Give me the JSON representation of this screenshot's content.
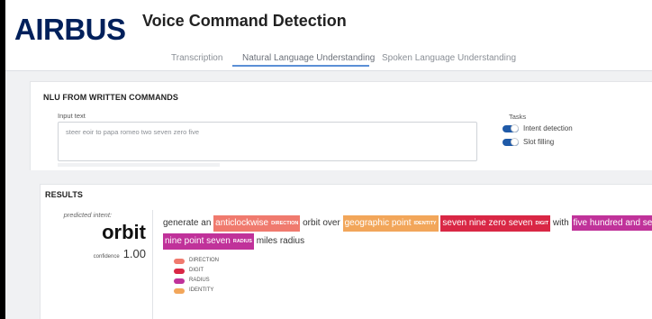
{
  "header": {
    "logo": "AIRBUS",
    "title": "Voice Command Detection",
    "tabs": [
      {
        "label": "Transcription",
        "active": false
      },
      {
        "label": "Natural Language Understanding",
        "active": true
      },
      {
        "label": "Spoken Language Understanding",
        "active": false
      }
    ]
  },
  "nlu": {
    "title": "NLU FROM WRITTEN COMMANDS",
    "input_label": "Input text",
    "input_value": "steer eoir to papa romeo two seven zero five",
    "tasks_label": "Tasks",
    "tasks": [
      {
        "label": "Intent detection",
        "enabled": true
      },
      {
        "label": "Slot filling",
        "enabled": true
      }
    ]
  },
  "results": {
    "title": "RESULTS",
    "predicted_intent_label": "predicted intent:",
    "intent": "orbit",
    "confidence_label": "confidence",
    "confidence": "1.00",
    "sentence": {
      "w1": "generate an",
      "e1": {
        "text": "anticlockwise",
        "tag": "DIRECTION",
        "color": "#f07a6e"
      },
      "w2": "orbit over",
      "e2": {
        "text": "geographic point",
        "tag": "IDENTITY",
        "color": "#f2a65a"
      },
      "e3": {
        "text": "seven nine zero seven",
        "tag": "DIGIT",
        "color": "#d92745"
      },
      "w3": "with",
      "e4a": {
        "text": "five hundred and seventy",
        "color": "#c0329a"
      },
      "e4b": {
        "text": "nine point seven",
        "tag": "RADIUS",
        "color": "#c0329a"
      },
      "w4": "miles radius"
    },
    "legend": [
      {
        "label": "DIRECTION",
        "color": "#f07a6e"
      },
      {
        "label": "DIGIT",
        "color": "#d92745"
      },
      {
        "label": "RADIUS",
        "color": "#c0329a"
      },
      {
        "label": "IDENTITY",
        "color": "#f2a65a"
      }
    ]
  }
}
